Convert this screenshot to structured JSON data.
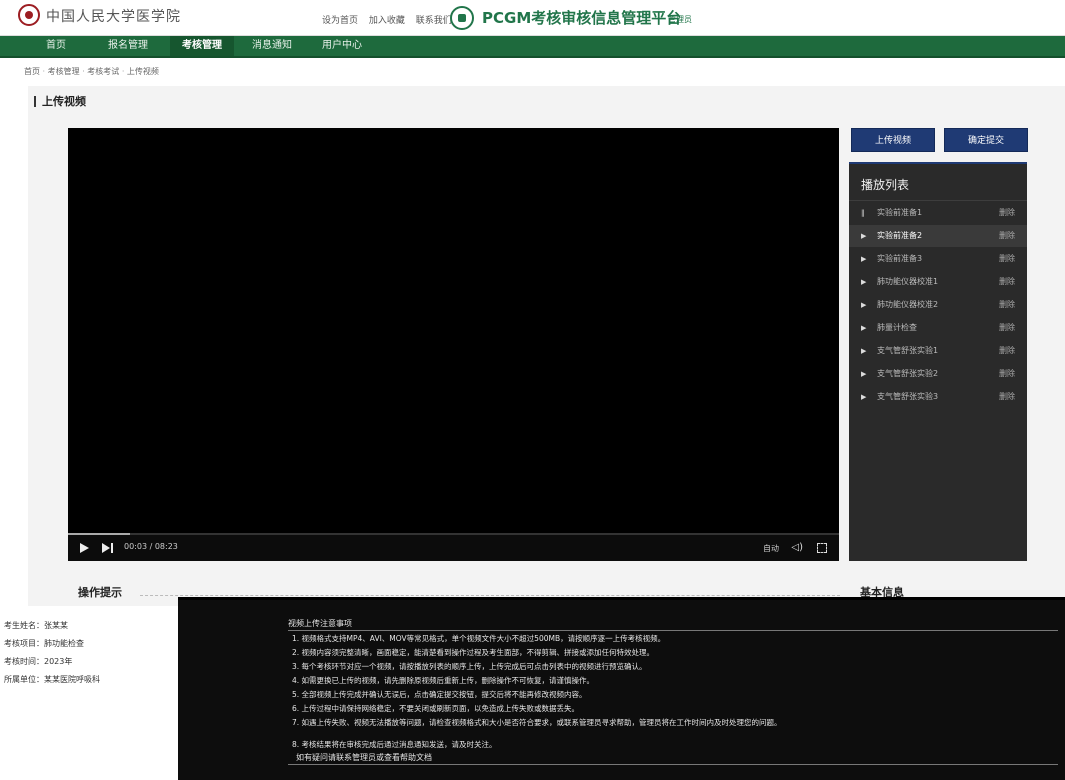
{
  "header": {
    "school_name": "中国人民大学医学院",
    "top_links": [
      "设为首页",
      "加入收藏",
      "联系我们"
    ],
    "brand_title": "PCGM考核审核信息管理平台",
    "brand_sub": "管理员"
  },
  "nav": {
    "items": [
      {
        "label": "首页",
        "active": false
      },
      {
        "label": "报名管理",
        "active": false
      },
      {
        "label": "考核管理",
        "active": true
      },
      {
        "label": "消息通知",
        "active": false
      },
      {
        "label": "用户中心",
        "active": false
      }
    ]
  },
  "breadcrumb": [
    "首页",
    "考核管理",
    "考核考试",
    "上传视频"
  ],
  "section_title": "上传视频",
  "video": {
    "time": "00:03 / 08:23",
    "auto_label": "自动",
    "progress": 0.08
  },
  "actions": {
    "upload_label": "上传视频",
    "confirm_label": "确定提交"
  },
  "playlist": {
    "title": "播放列表",
    "delete_label": "删除",
    "items": [
      {
        "name": "实验前准备1",
        "icon": "‖",
        "current": false
      },
      {
        "name": "实验前准备2",
        "icon": "▶",
        "current": true
      },
      {
        "name": "实验前准备3",
        "icon": "▶",
        "current": false
      },
      {
        "name": "肺功能仪器校准1",
        "icon": "▶",
        "current": false
      },
      {
        "name": "肺功能仪器校准2",
        "icon": "▶",
        "current": false
      },
      {
        "name": "肺量计检查",
        "icon": "▶",
        "current": false
      },
      {
        "name": "支气管舒张实验1",
        "icon": "▶",
        "current": false
      },
      {
        "name": "支气管舒张实验2",
        "icon": "▶",
        "current": false
      },
      {
        "name": "支气管舒张实验3",
        "icon": "▶",
        "current": false
      }
    ]
  },
  "tips_title": "操作提示",
  "info_title": "基本信息",
  "left_col": [
    "考生姓名：张某某",
    "考核项目：肺功能检查",
    "考核时间：2023年",
    "所属单位：某某医院呼吸科"
  ],
  "notes": {
    "title": "视频上传注意事项",
    "items": [
      "1. 视频格式支持MP4、AVI、MOV等常见格式，单个视频文件大小不超过500MB，请按顺序逐一上传考核视频。",
      "2. 视频内容须完整清晰，画面稳定，能清楚看到操作过程及考生面部，不得剪辑、拼接或添加任何特效处理。",
      "3. 每个考核环节对应一个视频，请按播放列表的顺序上传，上传完成后可点击列表中的视频进行预览确认。",
      "4. 如需更换已上传的视频，请先删除原视频后重新上传，删除操作不可恢复，请谨慎操作。",
      "5. 全部视频上传完成并确认无误后，点击确定提交按钮，提交后将不能再修改视频内容。",
      "6. 上传过程中请保持网络稳定，不要关闭或刷新页面，以免造成上传失败或数据丢失。",
      "7. 如遇上传失败、视频无法播放等问题，请检查视频格式和大小是否符合要求，或联系管理员寻求帮助，管理员将在工作时间内及时处理您的问题。",
      "8. 考核结果将在审核完成后通过消息通知发送，请及时关注。"
    ],
    "footer": "如有疑问请联系管理员或查看帮助文档"
  }
}
